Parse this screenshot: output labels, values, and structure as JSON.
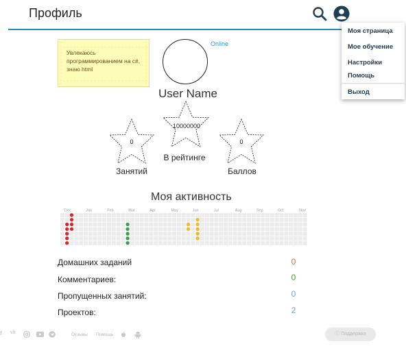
{
  "header": {
    "title": "Профиль"
  },
  "menu": {
    "items": [
      "Моя страница",
      "Мое обучение",
      "Настройки",
      "Помощь",
      "Выход"
    ]
  },
  "profile": {
    "note": "Увлекаюсь программированием на c#, знаю html",
    "status": "Online",
    "username": "User Name",
    "stars": [
      {
        "value": "0",
        "label": "Занятий"
      },
      {
        "value": "10000000",
        "label": "В рейтинге"
      },
      {
        "value": "0",
        "label": "Баллов"
      }
    ]
  },
  "activity": {
    "title": "Моя активность",
    "months": [
      "Dec",
      "Jan",
      "Feb",
      "Mar",
      "Apr",
      "May",
      "Jun",
      "Jul",
      "Aug",
      "Sep",
      "Oct",
      "Nov"
    ]
  },
  "stats": [
    {
      "label": "Домашних заданий",
      "value": "0",
      "color": "#e8692f"
    },
    {
      "label": "Комментариев:",
      "value": "0",
      "color": "#4a9a2a"
    },
    {
      "label": "Пропущенных занятий:",
      "value": "0",
      "color": "#6aa3d8"
    },
    {
      "label": "Проектов:",
      "value": "2",
      "color": "#6aa3d8"
    }
  ],
  "footer": {
    "links": [
      "Отзывы",
      "Помощь"
    ],
    "support": "Поддержка",
    "icons": [
      "facebook-icon",
      "vk-icon",
      "instagram-icon",
      "youtube-icon",
      "telegram-icon",
      "apple-icon",
      "android-icon"
    ]
  }
}
